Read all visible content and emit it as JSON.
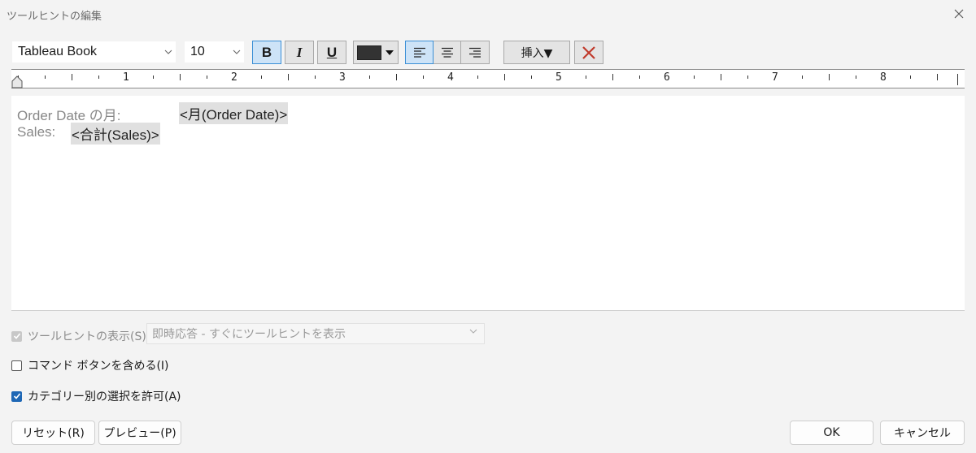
{
  "window": {
    "title": "ツールヒントの編集"
  },
  "toolbar": {
    "font_family": "Tableau Book",
    "font_size": "10",
    "bold_label": "B",
    "italic_label": "I",
    "underline_label": "U",
    "text_color": "#333333",
    "insert_label": "挿入▼"
  },
  "ruler": {
    "numbers": [
      "1",
      "2",
      "3",
      "4",
      "5",
      "6",
      "7",
      "8"
    ]
  },
  "editor": {
    "line1_label": "Order Date の月:",
    "line1_field": "<月(Order Date)>",
    "line2_label": "Sales:",
    "line2_field": "<合計(Sales)>"
  },
  "options": {
    "show_tooltip": {
      "label": "ツールヒントの表示(S)",
      "checked": true,
      "enabled": false
    },
    "show_tooltip_mode": "即時応答 - すぐにツールヒントを表示",
    "include_command_buttons": {
      "label": "コマンド ボタンを含める(I)",
      "checked": false
    },
    "allow_category_selection": {
      "label": "カテゴリー別の選択を許可(A)",
      "checked": true
    }
  },
  "buttons": {
    "reset": "リセット(R)",
    "preview": "プレビュー(P)",
    "ok": "OK",
    "cancel": "キャンセル"
  },
  "colors": {
    "accent": "#1e67b5",
    "active_button_bg": "#cde3f7",
    "active_button_border": "#3b8fd6",
    "clear_red": "#c0392b"
  }
}
